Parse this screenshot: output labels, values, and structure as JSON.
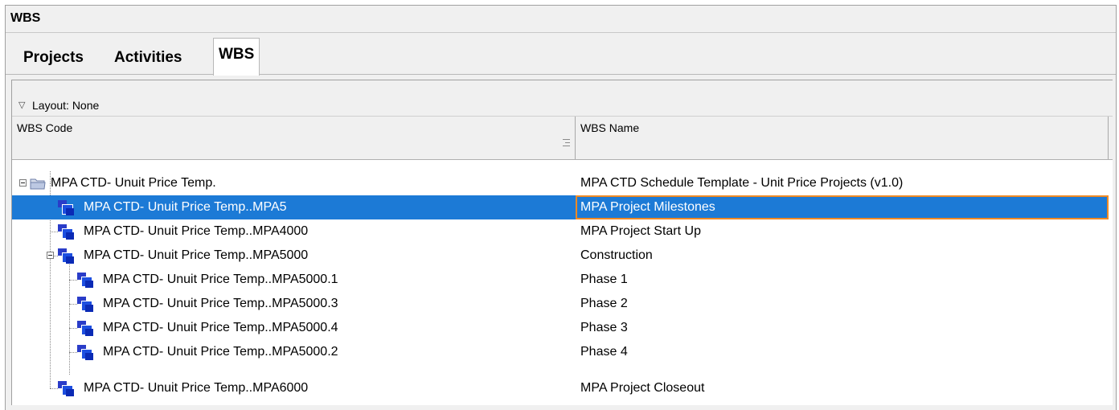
{
  "window": {
    "title": "WBS"
  },
  "tabs": [
    {
      "label": "Projects",
      "active": false
    },
    {
      "label": "Activities",
      "active": false
    },
    {
      "label": "WBS",
      "active": true
    }
  ],
  "layout": {
    "label": "Layout: None"
  },
  "columns": {
    "code": "WBS Code",
    "name": "WBS Name"
  },
  "rows": [
    {
      "code": "MPA CTD- Unuit Price Temp.",
      "name": "MPA CTD Schedule Template - Unit Price Projects (v1.0)",
      "icon": "folder-icon",
      "level": 0,
      "expanded": true,
      "selected": false
    },
    {
      "code": "MPA CTD- Unuit Price Temp..MPA5",
      "name": "MPA Project Milestones",
      "icon": "wbs-node-icon",
      "level": 1,
      "expanded": null,
      "selected": true
    },
    {
      "code": "MPA CTD- Unuit Price Temp..MPA4000",
      "name": "MPA Project Start Up",
      "icon": "wbs-node-icon",
      "level": 1,
      "expanded": null,
      "selected": false
    },
    {
      "code": "MPA CTD- Unuit Price Temp..MPA5000",
      "name": "Construction",
      "icon": "wbs-node-icon",
      "level": 1,
      "expanded": true,
      "selected": false
    },
    {
      "code": "MPA CTD- Unuit Price Temp..MPA5000.1",
      "name": "Phase 1",
      "icon": "wbs-node-icon",
      "level": 2,
      "expanded": null,
      "selected": false
    },
    {
      "code": "MPA CTD- Unuit Price Temp..MPA5000.3",
      "name": "Phase 2",
      "icon": "wbs-node-icon",
      "level": 2,
      "expanded": null,
      "selected": false
    },
    {
      "code": "MPA CTD- Unuit Price Temp..MPA5000.4",
      "name": "Phase 3",
      "icon": "wbs-node-icon",
      "level": 2,
      "expanded": null,
      "selected": false
    },
    {
      "code": "MPA CTD- Unuit Price Temp..MPA5000.2",
      "name": "Phase 4",
      "icon": "wbs-node-icon",
      "level": 2,
      "expanded": null,
      "selected": false
    },
    {
      "code": "MPA CTD- Unuit Price Temp..MPA6000",
      "name": "MPA Project Closeout",
      "icon": "wbs-node-icon",
      "level": 1,
      "expanded": null,
      "selected": false
    }
  ],
  "colors": {
    "selection": "#1c7ad6",
    "focus_border": "#f08a24",
    "wbs_icon": "#1d4fe0"
  }
}
